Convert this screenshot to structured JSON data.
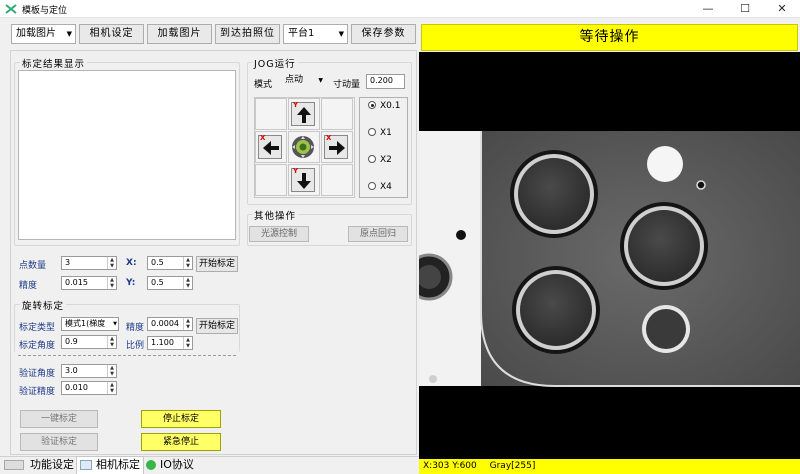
{
  "window": {
    "title": "模板与定位",
    "minimize": "—",
    "maximize": "☐",
    "close": "✕"
  },
  "toolbar": {
    "load_image_combo": "加载图片",
    "camera_settings": "相机设定",
    "load_image": "加载图片",
    "go_to_photo_pos": "到达拍照位",
    "platform_combo": "平台1",
    "save_params": "保存参数"
  },
  "status_banner": {
    "text": "等待操作",
    "color": "#ffff00"
  },
  "calib_display": {
    "title": "标定结果显示"
  },
  "jog": {
    "title": "JOG运行",
    "mode_label": "模式",
    "mode_value": "点动",
    "step_label": "寸动量",
    "step_value": "0.200",
    "up_label": "Y",
    "down_label": "Y",
    "left_label": "X",
    "right_label": "X",
    "ratios": [
      {
        "label": "X0.1",
        "selected": true
      },
      {
        "label": "X1",
        "selected": false
      },
      {
        "label": "X2",
        "selected": false
      },
      {
        "label": "X4",
        "selected": false
      }
    ]
  },
  "other_ops": {
    "title": "其他操作",
    "light_control": "光源控制",
    "home": "原点回归"
  },
  "points": {
    "count_label": "点数量",
    "count_value": "3",
    "x_label": "X:",
    "x_value": "0.5",
    "precision_label": "精度",
    "precision_value": "0.015",
    "y_label": "Y:",
    "y_value": "0.5",
    "start_btn": "开始标定"
  },
  "rotation": {
    "title": "旋转标定",
    "type_label": "标定类型",
    "type_value": "模式1(梯度",
    "precision_label": "精度",
    "precision_value": "0.0004",
    "start_btn": "开始标定",
    "angle_label": "标定角度",
    "angle_value": "0.9",
    "ratio_label": "比例",
    "ratio_value": "1.100"
  },
  "verify": {
    "angle_label": "验证角度",
    "angle_value": "3.0",
    "precision_label": "验证精度",
    "precision_value": "0.010"
  },
  "actions": {
    "one_key": "一键标定",
    "stop": "停止标定",
    "verify": "验证标定",
    "emergency": "紧急停止"
  },
  "tabs": [
    {
      "label": "功能设定"
    },
    {
      "label": "相机标定"
    },
    {
      "label": "IO协议"
    }
  ],
  "statusbar": {
    "coords": "X:303  Y:600",
    "gray": "Gray[255]"
  }
}
